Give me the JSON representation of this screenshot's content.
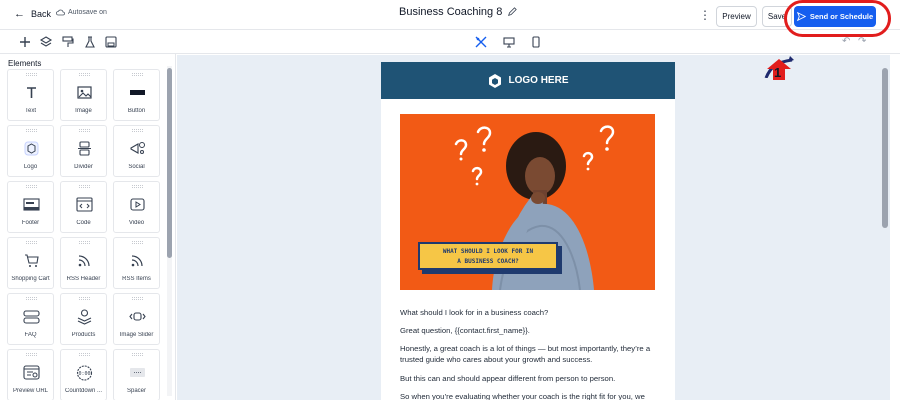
{
  "topbar": {
    "back_label": "Back",
    "autosave_label": "Autosave on",
    "title": "Business Coaching 8",
    "preview_label": "Preview",
    "save_label": "Save",
    "send_label": "Send or Schedule"
  },
  "left_panel": {
    "heading": "Elements",
    "items": [
      {
        "label": "Text",
        "icon": "text-icon"
      },
      {
        "label": "Image",
        "icon": "image-icon"
      },
      {
        "label": "Button",
        "icon": "button-icon"
      },
      {
        "label": "Logo",
        "icon": "logo-icon"
      },
      {
        "label": "Divider",
        "icon": "divider-icon"
      },
      {
        "label": "Social",
        "icon": "social-icon"
      },
      {
        "label": "Footer",
        "icon": "footer-icon"
      },
      {
        "label": "Code",
        "icon": "code-icon"
      },
      {
        "label": "Video",
        "icon": "video-icon"
      },
      {
        "label": "Shopping Cart",
        "icon": "cart-icon"
      },
      {
        "label": "RSS Header",
        "icon": "rss-icon"
      },
      {
        "label": "RSS Items",
        "icon": "rss-icon"
      },
      {
        "label": "FAQ",
        "icon": "faq-icon"
      },
      {
        "label": "Products",
        "icon": "products-icon"
      },
      {
        "label": "Image Slider",
        "icon": "slider-icon"
      },
      {
        "label": "Preview URL",
        "icon": "preview-url-icon"
      },
      {
        "label": "Countdown ...",
        "icon": "countdown-icon"
      },
      {
        "label": "Spacer",
        "icon": "spacer-icon"
      }
    ]
  },
  "email": {
    "logo_text": "LOGO HERE",
    "banner_line1": "WHAT SHOULD I LOOK FOR IN",
    "banner_line2": "A BUSINESS COACH?",
    "paragraphs": [
      "What should I look for in a business coach?",
      "Great question, {{contact.first_name}}.",
      "Honestly, a great coach is a lot of things — but most importantly, they’re a trusted guide who cares about your growth and success.",
      "But this can and should appear different from person to person.",
      "So when you’re evaluating whether your coach is the right fit for you, we"
    ]
  },
  "annotation": {
    "marker_number": "1"
  },
  "colors": {
    "accent": "#155eef",
    "email_header": "#1f5375",
    "hero_bg": "#f25a15",
    "banner": "#f6c646",
    "annotation_red": "#e11d1d"
  }
}
